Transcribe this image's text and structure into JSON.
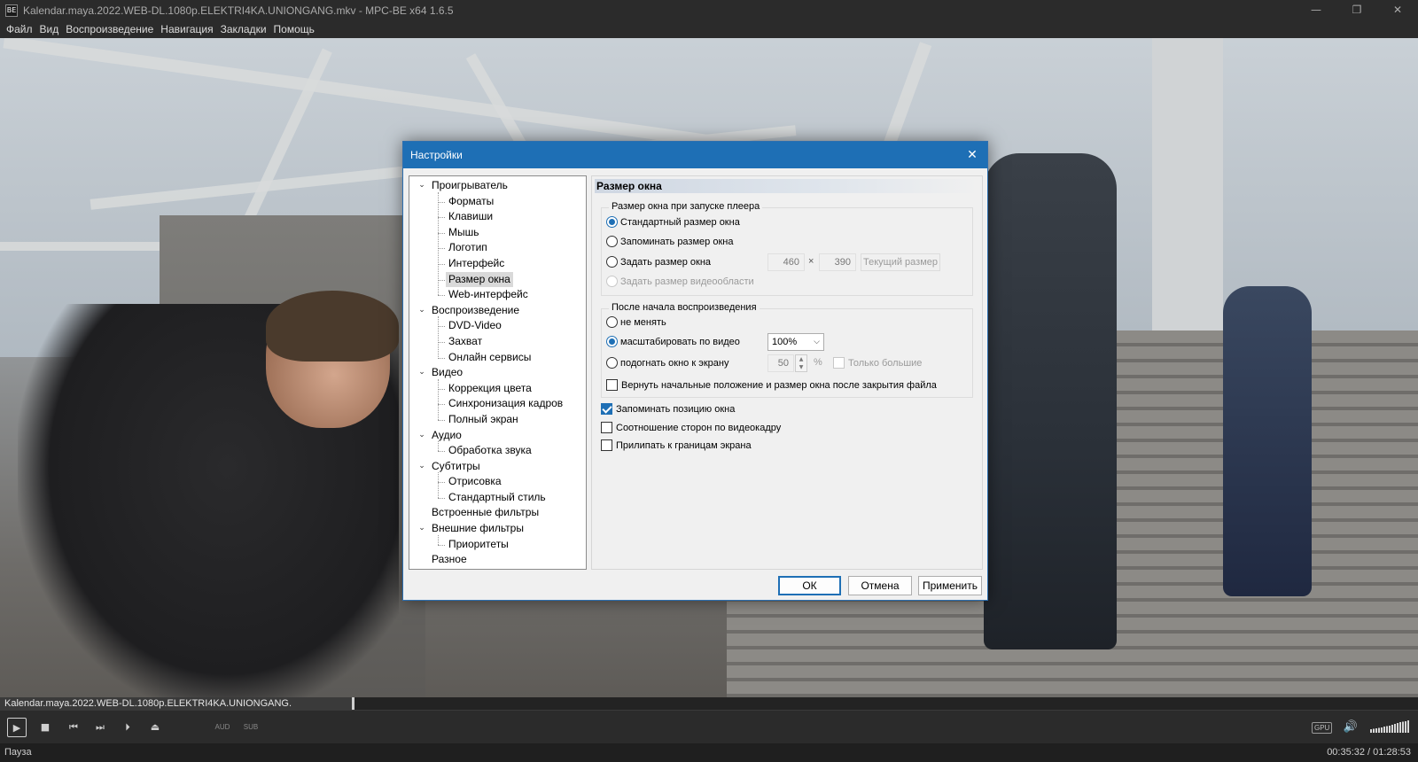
{
  "window": {
    "icon_text": "BE",
    "title": "Kalendar.maya.2022.WEB-DL.1080p.ELEKTRI4KA.UNIONGANG.mkv - MPC-BE x64 1.6.5",
    "minimize_glyph": "—",
    "maximize_glyph": "❐",
    "close_glyph": "✕"
  },
  "menu": [
    "Файл",
    "Вид",
    "Воспроизведение",
    "Навигация",
    "Закладки",
    "Помощь"
  ],
  "dialog": {
    "title": "Настройки",
    "close_glyph": "✕",
    "tree": [
      {
        "label": "Проигрыватель",
        "level": 0,
        "expanded": true
      },
      {
        "label": "Форматы",
        "level": 1
      },
      {
        "label": "Клавиши",
        "level": 1
      },
      {
        "label": "Мышь",
        "level": 1
      },
      {
        "label": "Логотип",
        "level": 1
      },
      {
        "label": "Интерфейс",
        "level": 1
      },
      {
        "label": "Размер окна",
        "level": 1,
        "selected": true
      },
      {
        "label": "Web-интерфейс",
        "level": 1
      },
      {
        "label": "Воспроизведение",
        "level": 0,
        "expanded": true
      },
      {
        "label": "DVD-Video",
        "level": 1
      },
      {
        "label": "Захват",
        "level": 1
      },
      {
        "label": "Онлайн сервисы",
        "level": 1
      },
      {
        "label": "Видео",
        "level": 0,
        "expanded": true
      },
      {
        "label": "Коррекция цвета",
        "level": 1
      },
      {
        "label": "Синхронизация кадров",
        "level": 1
      },
      {
        "label": "Полный экран",
        "level": 1
      },
      {
        "label": "Аудио",
        "level": 0,
        "expanded": true
      },
      {
        "label": "Обработка звука",
        "level": 1
      },
      {
        "label": "Субтитры",
        "level": 0,
        "expanded": true
      },
      {
        "label": "Отрисовка",
        "level": 1
      },
      {
        "label": "Стандартный стиль",
        "level": 1
      },
      {
        "label": "Встроенные фильтры",
        "level": 0
      },
      {
        "label": "Внешние фильтры",
        "level": 0,
        "expanded": true
      },
      {
        "label": "Приоритеты",
        "level": 1
      },
      {
        "label": "Разное",
        "level": 0
      }
    ],
    "panel": {
      "header": "Размер окна",
      "group1": {
        "caption": "Размер окна при запуске плеера",
        "opt_standard": "Стандартный размер окна",
        "opt_remember": "Запоминать размер окна",
        "opt_set": "Задать размер окна",
        "width": "460",
        "times": "×",
        "height": "390",
        "current_size_button": "Текущий размер",
        "opt_video_area": "Задать размер видеообласти"
      },
      "group2": {
        "caption": "После начала воспроизведения",
        "opt_no_change": "не менять",
        "opt_scale": "масштабировать по видео",
        "scale_value": "100%",
        "opt_fit": "подогнать окно к экрану",
        "fit_value": "50",
        "percent": "%",
        "only_bigger": "Только большие",
        "restore": "Вернуть начальные положение и размер окна после закрытия файла"
      },
      "remember_pos": "Запоминать позицию окна",
      "aspect": "Соотношение сторон по видеокадру",
      "snap": "Прилипать к границам экрана"
    },
    "buttons": {
      "ok": "ОК",
      "cancel": "Отмена",
      "apply": "Применить"
    }
  },
  "seekbar": {
    "filename": "Kalendar.maya.2022.WEB-DL.1080p.ELEKTRI4KA.UNIONGANG.",
    "progress": 0.25
  },
  "controls": {
    "play": "▶",
    "stop": "■",
    "prev": "⏮",
    "next": "⏭",
    "frame": "⏵",
    "eject": "⏏",
    "audio_tag": "AUD",
    "sub_tag": "SUB",
    "gpu_tag": "GPU",
    "volume_icon": "🔊"
  },
  "status": {
    "state": "Пауза",
    "time": "00:35:32 / 01:28:53"
  }
}
